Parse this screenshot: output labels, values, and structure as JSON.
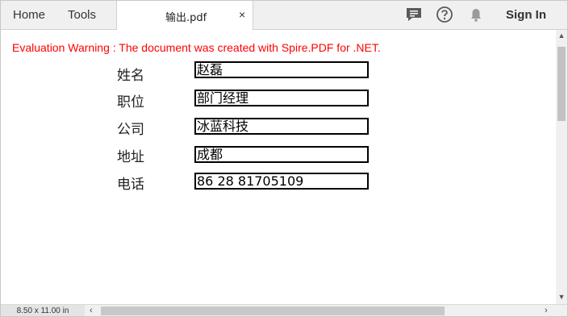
{
  "toolbar": {
    "home_label": "Home",
    "tools_label": "Tools",
    "signin_label": "Sign In"
  },
  "tab": {
    "title": "输出.pdf",
    "close_glyph": "×"
  },
  "document": {
    "warning": "Evaluation Warning : The document was created with Spire.PDF for .NET.",
    "fields": [
      {
        "label": "姓名",
        "value": "赵磊"
      },
      {
        "label": "职位",
        "value": "部门经理"
      },
      {
        "label": "公司",
        "value": "冰蓝科技"
      },
      {
        "label": "地址",
        "value": "成都"
      },
      {
        "label": "电话",
        "value": "86 28 81705109"
      }
    ]
  },
  "status": {
    "page_size": "8.50 x 11.00 in"
  },
  "icons": [
    "chat-icon",
    "help-icon",
    "bell-icon",
    "close-icon",
    "scroll-arrow-icon"
  ],
  "colors": {
    "warning": "#ff0000",
    "toolbar_bg": "#f0f0f0",
    "field_border": "#000000"
  }
}
